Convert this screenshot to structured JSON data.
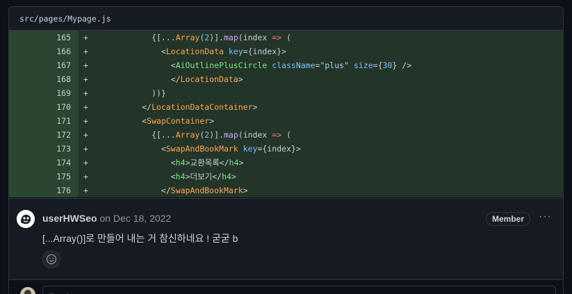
{
  "file": {
    "path": "src/pages/Mypage.js"
  },
  "diff": {
    "marker": "+",
    "lines": [
      {
        "num": "165",
        "tokens": [
          {
            "t": "            {[...",
            "c": "p"
          },
          {
            "t": "Array",
            "c": "c"
          },
          {
            "t": "(",
            "c": "p"
          },
          {
            "t": "2",
            "c": "a"
          },
          {
            "t": ")].",
            "c": "p"
          },
          {
            "t": "map",
            "c": "f"
          },
          {
            "t": "(index ",
            "c": "p"
          },
          {
            "t": "=>",
            "c": "o"
          },
          {
            "t": " (",
            "c": "p"
          }
        ]
      },
      {
        "num": "166",
        "tokens": [
          {
            "t": "              <",
            "c": "p"
          },
          {
            "t": "LocationData",
            "c": "c"
          },
          {
            "t": " ",
            "c": "p"
          },
          {
            "t": "key",
            "c": "a"
          },
          {
            "t": "={index}>",
            "c": "p"
          }
        ]
      },
      {
        "num": "167",
        "tokens": [
          {
            "t": "                <",
            "c": "p"
          },
          {
            "t": "AiOutlinePlusCircle",
            "c": "t"
          },
          {
            "t": " ",
            "c": "p"
          },
          {
            "t": "className",
            "c": "a"
          },
          {
            "t": "=",
            "c": "p"
          },
          {
            "t": "\"plus\"",
            "c": "s"
          },
          {
            "t": " ",
            "c": "p"
          },
          {
            "t": "size",
            "c": "a"
          },
          {
            "t": "={",
            "c": "p"
          },
          {
            "t": "30",
            "c": "a"
          },
          {
            "t": "} />",
            "c": "p"
          }
        ]
      },
      {
        "num": "168",
        "tokens": [
          {
            "t": "                </",
            "c": "p"
          },
          {
            "t": "LocationData",
            "c": "c"
          },
          {
            "t": ">",
            "c": "p"
          }
        ]
      },
      {
        "num": "169",
        "tokens": [
          {
            "t": "            ))}",
            "c": "p"
          }
        ]
      },
      {
        "num": "170",
        "tokens": [
          {
            "t": "          </",
            "c": "p"
          },
          {
            "t": "LocationDataContainer",
            "c": "c"
          },
          {
            "t": ">",
            "c": "p"
          }
        ]
      },
      {
        "num": "171",
        "tokens": [
          {
            "t": "          <",
            "c": "p"
          },
          {
            "t": "SwapContainer",
            "c": "c"
          },
          {
            "t": ">",
            "c": "p"
          }
        ]
      },
      {
        "num": "172",
        "tokens": [
          {
            "t": "            {[...",
            "c": "p"
          },
          {
            "t": "Array",
            "c": "c"
          },
          {
            "t": "(",
            "c": "p"
          },
          {
            "t": "2",
            "c": "a"
          },
          {
            "t": ")].",
            "c": "p"
          },
          {
            "t": "map",
            "c": "f"
          },
          {
            "t": "(index ",
            "c": "p"
          },
          {
            "t": "=>",
            "c": "o"
          },
          {
            "t": " (",
            "c": "p"
          }
        ]
      },
      {
        "num": "173",
        "tokens": [
          {
            "t": "              <",
            "c": "p"
          },
          {
            "t": "SwapAndBookMark",
            "c": "c"
          },
          {
            "t": " ",
            "c": "p"
          },
          {
            "t": "key",
            "c": "a"
          },
          {
            "t": "={index}>",
            "c": "p"
          }
        ]
      },
      {
        "num": "174",
        "tokens": [
          {
            "t": "                <",
            "c": "p"
          },
          {
            "t": "h4",
            "c": "t"
          },
          {
            "t": ">교환목록</",
            "c": "p"
          },
          {
            "t": "h4",
            "c": "t"
          },
          {
            "t": ">",
            "c": "p"
          }
        ]
      },
      {
        "num": "175",
        "tokens": [
          {
            "t": "                <",
            "c": "p"
          },
          {
            "t": "h4",
            "c": "t"
          },
          {
            "t": ">더보기</",
            "c": "p"
          },
          {
            "t": "h4",
            "c": "t"
          },
          {
            "t": ">",
            "c": "p"
          }
        ]
      },
      {
        "num": "176",
        "tokens": [
          {
            "t": "              </",
            "c": "p"
          },
          {
            "t": "SwapAndBookMark",
            "c": "c"
          },
          {
            "t": ">",
            "c": "p"
          }
        ]
      }
    ]
  },
  "comment": {
    "author": "userHWSeo",
    "date": " on Dec 18, 2022",
    "badge": "Member",
    "more": "···",
    "body": "[...Array()]로 만들어 내는 거 참신하네요 ! 굳굳 b"
  },
  "reply": {
    "placeholder": "Reply..."
  },
  "colors": {
    "added_line_bg": "#233428",
    "added_num_bg": "#2b4530",
    "panel_bg": "#161b22",
    "border": "#30363d"
  }
}
